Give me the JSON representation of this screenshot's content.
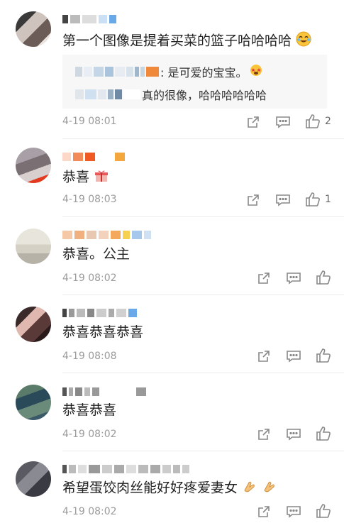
{
  "comments": [
    {
      "text": "第一个图像是提着买菜的篮子哈哈哈哈",
      "time": "4-19 08:01",
      "likes": "2",
      "replies": [
        {
          "text": ": 是可爱的宝宝。"
        },
        {
          "text": "真的很像，哈哈哈哈哈哈"
        }
      ]
    },
    {
      "text": "恭喜",
      "time": "4-19 08:03",
      "likes": "1"
    },
    {
      "text": "恭喜。公主",
      "time": "4-19 08:02",
      "likes": ""
    },
    {
      "text": "恭喜恭喜恭喜",
      "time": "4-19 08:08",
      "likes": ""
    },
    {
      "text": "恭喜恭喜",
      "time": "4-19 08:02",
      "likes": ""
    },
    {
      "text": "希望蛋饺肉丝能好好疼爱妻女",
      "time": "4-19 08:02",
      "likes": ""
    }
  ],
  "icons": {
    "share": "share-icon",
    "comment": "comment-icon",
    "like": "thumbs-up-icon"
  },
  "colors": {
    "text": "#222222",
    "meta": "#9b9b9b",
    "reply_bg": "#f7f7f7"
  }
}
